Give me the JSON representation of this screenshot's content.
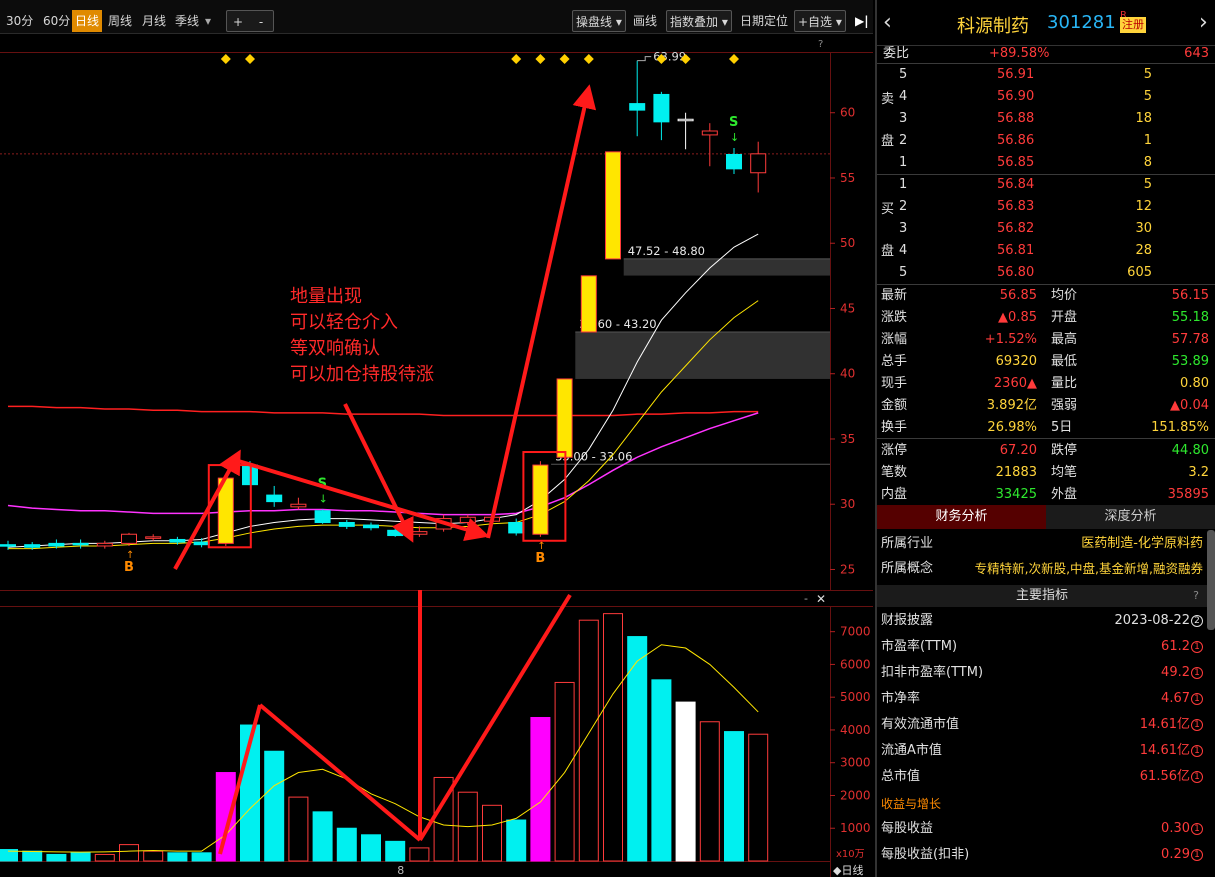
{
  "toolbar": {
    "periods": [
      "30分",
      "60分",
      "日线",
      "周线",
      "月线",
      "季线"
    ],
    "active_period": "日线",
    "zoom_in": "+",
    "zoom_out": "-",
    "right_items": [
      "操盘线",
      "画线",
      "指数叠加",
      "日期定位",
      "+自选"
    ],
    "collapse": "▶|",
    "help": "?"
  },
  "chart_data": {
    "type": "candlestick",
    "price_axis_ticks": [
      25,
      30,
      35,
      40,
      45,
      50,
      55,
      60
    ],
    "price_range": [
      24.5,
      64.5
    ],
    "volume_axis_ticks": [
      1000,
      2000,
      3000,
      4000,
      5000,
      6000,
      7000
    ],
    "volume_range": [
      0,
      7600
    ],
    "volume_unit": "x10万",
    "last_price_line": 56.85,
    "high_label": "63.99",
    "gap_labels": [
      "47.52 - 48.80",
      "39.60 - 43.20",
      "33.00 - 33.06"
    ],
    "gaps": [
      {
        "lo": 47.52,
        "hi": 48.8
      },
      {
        "lo": 39.6,
        "hi": 43.2
      },
      {
        "lo": 33.0,
        "hi": 33.06
      }
    ],
    "candles": [
      {
        "o": 26.8,
        "c": 26.9,
        "h": 27.2,
        "l": 26.5,
        "color": "cyan",
        "v": 350
      },
      {
        "o": 26.9,
        "c": 26.7,
        "h": 27.1,
        "l": 26.5,
        "color": "cyan",
        "v": 300
      },
      {
        "o": 26.8,
        "c": 27.0,
        "h": 27.3,
        "l": 26.6,
        "color": "cyan",
        "v": 200
      },
      {
        "o": 26.9,
        "c": 27.0,
        "h": 27.3,
        "l": 26.6,
        "color": "cyan",
        "v": 250
      },
      {
        "o": 27.0,
        "c": 26.8,
        "h": 27.2,
        "l": 26.6,
        "color": "red",
        "v": 200
      },
      {
        "o": 27.0,
        "c": 27.7,
        "h": 27.8,
        "l": 26.8,
        "color": "red",
        "v": 500
      },
      {
        "o": 27.4,
        "c": 27.5,
        "h": 27.7,
        "l": 27.2,
        "color": "red",
        "v": 300
      },
      {
        "o": 27.1,
        "c": 27.3,
        "h": 27.5,
        "l": 26.9,
        "color": "cyan",
        "v": 250
      },
      {
        "o": 26.9,
        "c": 27.1,
        "h": 27.4,
        "l": 26.7,
        "color": "cyan",
        "v": 250
      },
      {
        "o": 27.0,
        "c": 32.0,
        "h": 32.0,
        "l": 26.8,
        "color": "yellow",
        "v": 2700
      },
      {
        "o": 33.0,
        "c": 31.5,
        "h": 33.3,
        "l": 31.5,
        "color": "cyan",
        "v": 4150
      },
      {
        "o": 30.7,
        "c": 30.2,
        "h": 31.4,
        "l": 29.8,
        "color": "cyan",
        "v": 3350
      },
      {
        "o": 29.8,
        "c": 30.0,
        "h": 30.5,
        "l": 29.6,
        "color": "red",
        "v": 1950
      },
      {
        "o": 29.5,
        "c": 28.6,
        "h": 29.6,
        "l": 28.5,
        "color": "cyan",
        "v": 1500
      },
      {
        "o": 28.6,
        "c": 28.3,
        "h": 28.8,
        "l": 28.1,
        "color": "cyan",
        "v": 1000
      },
      {
        "o": 28.4,
        "c": 28.2,
        "h": 28.6,
        "l": 28.0,
        "color": "cyan",
        "v": 800
      },
      {
        "o": 28.0,
        "c": 27.6,
        "h": 28.2,
        "l": 27.5,
        "color": "cyan",
        "v": 600
      },
      {
        "o": 27.7,
        "c": 27.9,
        "h": 28.3,
        "l": 27.5,
        "color": "red",
        "v": 400
      },
      {
        "o": 28.1,
        "c": 28.9,
        "h": 29.2,
        "l": 27.9,
        "color": "red",
        "v": 2550
      },
      {
        "o": 28.6,
        "c": 29.0,
        "h": 29.2,
        "l": 28.4,
        "color": "red",
        "v": 2100
      },
      {
        "o": 28.7,
        "c": 29.0,
        "h": 29.2,
        "l": 28.5,
        "color": "red",
        "v": 1700
      },
      {
        "o": 28.6,
        "c": 27.8,
        "h": 28.9,
        "l": 27.6,
        "color": "cyan",
        "v": 1250
      },
      {
        "o": 27.7,
        "c": 33.0,
        "h": 33.3,
        "l": 27.5,
        "color": "yellow",
        "v": 4380
      },
      {
        "o": 33.6,
        "c": 39.6,
        "h": 39.6,
        "l": 33.4,
        "color": "yellow",
        "v": 5450
      },
      {
        "o": 43.2,
        "c": 47.5,
        "h": 47.5,
        "l": 43.2,
        "color": "yellow",
        "v": 7350
      },
      {
        "o": 48.8,
        "c": 57.0,
        "h": 57.0,
        "l": 48.8,
        "color": "yellow",
        "v": 7550
      },
      {
        "o": 60.2,
        "c": 60.7,
        "h": 63.99,
        "l": 58.2,
        "color": "cyan",
        "v": 6850
      },
      {
        "o": 61.4,
        "c": 59.3,
        "h": 61.6,
        "l": 57.9,
        "color": "cyan",
        "v": 5530
      },
      {
        "o": 59.4,
        "c": 59.5,
        "h": 60.0,
        "l": 57.2,
        "color": "white",
        "v": 4850
      },
      {
        "o": 58.3,
        "c": 58.6,
        "h": 59.2,
        "l": 55.9,
        "color": "red",
        "v": 4250
      },
      {
        "o": 55.7,
        "c": 56.8,
        "h": 57.3,
        "l": 55.3,
        "color": "cyan",
        "v": 3950
      },
      {
        "o": 55.4,
        "c": 56.85,
        "h": 57.78,
        "l": 53.89,
        "color": "red",
        "v": 3870
      }
    ],
    "ma_white": [
      26.7,
      26.8,
      26.9,
      27.0,
      27.0,
      27.1,
      27.2,
      27.2,
      27.3,
      27.8,
      28.3,
      28.6,
      28.8,
      28.9,
      28.9,
      28.8,
      28.7,
      28.6,
      28.5,
      28.6,
      28.9,
      29.2,
      30.3,
      31.9,
      34.2,
      37.2,
      40.9,
      44.1,
      46.2,
      48.1,
      49.7,
      50.7
    ],
    "ma_yellow": [
      26.6,
      26.6,
      26.7,
      26.8,
      26.8,
      26.9,
      27.0,
      27.0,
      27.1,
      27.4,
      27.8,
      28.1,
      28.3,
      28.4,
      28.4,
      28.4,
      28.3,
      28.2,
      28.2,
      28.3,
      28.5,
      28.6,
      29.2,
      30.2,
      31.8,
      33.8,
      36.2,
      38.6,
      40.6,
      42.6,
      44.3,
      45.6
    ],
    "ma_magenta": [
      29.9,
      29.7,
      29.6,
      29.5,
      29.5,
      29.4,
      29.3,
      29.3,
      29.3,
      29.4,
      29.5,
      29.5,
      29.6,
      29.6,
      29.5,
      29.5,
      29.4,
      29.3,
      29.2,
      29.2,
      29.2,
      29.3,
      29.8,
      30.5,
      31.5,
      32.6,
      33.6,
      34.4,
      35.1,
      35.8,
      36.4,
      37.0
    ],
    "ma_red": [
      37.5,
      37.5,
      37.4,
      37.4,
      37.3,
      37.3,
      37.2,
      37.2,
      37.1,
      37.1,
      37.1,
      37.0,
      37.0,
      37.0,
      36.9,
      36.9,
      36.9,
      36.9,
      36.8,
      36.8,
      36.8,
      36.8,
      36.8,
      36.8,
      36.8,
      36.8,
      36.9,
      36.9,
      37.0,
      37.0,
      37.1,
      37.1
    ],
    "vol_ma": [
      300,
      290,
      280,
      270,
      280,
      300,
      320,
      300,
      300,
      800,
      1600,
      2300,
      2700,
      2800,
      2500,
      2050,
      1750,
      1350,
      1100,
      1050,
      1100,
      1300,
      1800,
      2700,
      3900,
      5100,
      6100,
      6600,
      6500,
      6000,
      5300,
      4550
    ],
    "b_marks": [
      5,
      22
    ],
    "s_marks": [
      13,
      30
    ],
    "diamonds": [
      9,
      10,
      21,
      22,
      23,
      24,
      27,
      28,
      30
    ],
    "x_tick_label": "8",
    "period_tag": "日线"
  },
  "annotation": {
    "lines": [
      "地量出现",
      "可以轻仓介入",
      "等双响确认",
      "可以加仓持股待涨"
    ]
  },
  "quote": {
    "name": "科源制药",
    "code": "301281",
    "r_mark": "R",
    "reg_tag": "注册",
    "weibi_label": "委比",
    "weibi": "+89.58%",
    "weicha": "643",
    "sell_label": [
      "卖",
      "盘"
    ],
    "buy_label": [
      "买",
      "盘"
    ],
    "sell": [
      {
        "lvl": "5",
        "p": "56.91",
        "v": "5"
      },
      {
        "lvl": "4",
        "p": "56.90",
        "v": "5"
      },
      {
        "lvl": "3",
        "p": "56.88",
        "v": "18"
      },
      {
        "lvl": "2",
        "p": "56.86",
        "v": "1"
      },
      {
        "lvl": "1",
        "p": "56.85",
        "v": "8"
      }
    ],
    "buy": [
      {
        "lvl": "1",
        "p": "56.84",
        "v": "5"
      },
      {
        "lvl": "2",
        "p": "56.83",
        "v": "12"
      },
      {
        "lvl": "3",
        "p": "56.82",
        "v": "30"
      },
      {
        "lvl": "4",
        "p": "56.81",
        "v": "28"
      },
      {
        "lvl": "5",
        "p": "56.80",
        "v": "605"
      }
    ],
    "stats": [
      {
        "l1": "最新",
        "v1": "56.85",
        "c1": "red",
        "l2": "均价",
        "v2": "56.15",
        "c2": "red"
      },
      {
        "l1": "涨跌",
        "v1": "▲0.85",
        "c1": "red",
        "l2": "开盘",
        "v2": "55.18",
        "c2": "green"
      },
      {
        "l1": "涨幅",
        "v1": "+1.52%",
        "c1": "red",
        "l2": "最高",
        "v2": "57.78",
        "c2": "red"
      },
      {
        "l1": "总手",
        "v1": "69320",
        "c1": "yellow",
        "l2": "最低",
        "v2": "53.89",
        "c2": "green"
      },
      {
        "l1": "现手",
        "v1": "2360▲",
        "c1": "red",
        "l2": "量比",
        "v2": "0.80",
        "c2": "yellow"
      },
      {
        "l1": "金额",
        "v1": "3.892亿",
        "c1": "yellow",
        "l2": "强弱",
        "v2": "▲0.04",
        "c2": "red"
      },
      {
        "l1": "换手",
        "v1": "26.98%",
        "c1": "yellow",
        "l2": "5日",
        "v2": "151.85%",
        "c2": "yellow"
      },
      {
        "l1": "涨停",
        "v1": "67.20",
        "c1": "red",
        "l2": "跌停",
        "v2": "44.80",
        "c2": "green"
      },
      {
        "l1": "笔数",
        "v1": "21883",
        "c1": "yellow",
        "l2": "均笔",
        "v2": "3.2",
        "c2": "yellow"
      },
      {
        "l1": "内盘",
        "v1": "33425",
        "c1": "green",
        "l2": "外盘",
        "v2": "35895",
        "c2": "red"
      }
    ]
  },
  "fundamentals": {
    "tab_finance": "财务分析",
    "tab_depth": "深度分析",
    "industry_label": "所属行业",
    "industry": "医药制造-化学原料药",
    "concept_label": "所属概念",
    "concept": "专精特新,次新股,中盘,基金新增,融资融券",
    "section": "主要指标",
    "section_help": "?",
    "rows": [
      {
        "k": "财报披露",
        "v": "2023-08-22",
        "n": "2"
      },
      {
        "k": "市盈率(TTM)",
        "v": "61.2",
        "n": "1"
      },
      {
        "k": "扣非市盈率(TTM)",
        "v": "49.2",
        "n": "1"
      },
      {
        "k": "市净率",
        "v": "4.67",
        "n": "1"
      },
      {
        "k": "有效流通市值",
        "v": "14.61亿",
        "n": "1"
      },
      {
        "k": "流通A市值",
        "v": "14.61亿",
        "n": "1"
      },
      {
        "k": "总市值",
        "v": "61.56亿",
        "n": "1"
      }
    ],
    "growth_header": "收益与增长",
    "rows2": [
      {
        "k": "每股收益",
        "v": "0.30",
        "n": "1"
      },
      {
        "k": "每股收益(扣非)",
        "v": "0.29",
        "n": "1"
      }
    ]
  }
}
